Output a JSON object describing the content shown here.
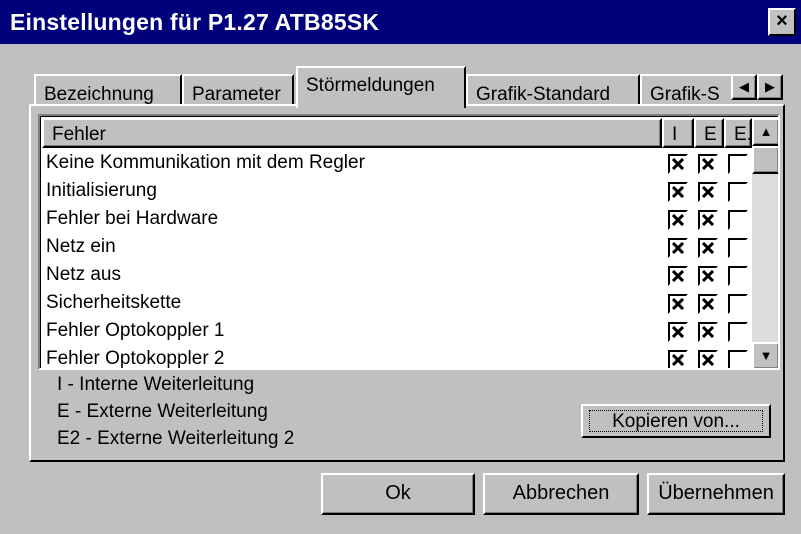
{
  "window": {
    "title": "Einstellungen für P1.27 ATB85SK",
    "close_label": "×"
  },
  "tabs": [
    {
      "label": "Bezeichnung",
      "active": false
    },
    {
      "label": "Parameter",
      "active": false
    },
    {
      "label": "Störmeldungen",
      "active": true
    },
    {
      "label": "Grafik-Standard",
      "active": false
    },
    {
      "label": "Grafik-S",
      "active": false
    }
  ],
  "tab_scroll": {
    "left": "◀",
    "right": "▶"
  },
  "list": {
    "columns": {
      "fehler": "Fehler",
      "i": "I",
      "e": "E",
      "e2": "E.."
    },
    "rows": [
      {
        "label": "Keine Kommunikation mit dem Regler",
        "i": true,
        "e": true,
        "e2": false
      },
      {
        "label": "Initialisierung",
        "i": true,
        "e": true,
        "e2": false
      },
      {
        "label": "Fehler bei Hardware",
        "i": true,
        "e": true,
        "e2": false
      },
      {
        "label": "Netz ein",
        "i": true,
        "e": true,
        "e2": false
      },
      {
        "label": "Netz aus",
        "i": true,
        "e": true,
        "e2": false
      },
      {
        "label": "Sicherheitskette",
        "i": true,
        "e": true,
        "e2": false
      },
      {
        "label": "Fehler Optokoppler 1",
        "i": true,
        "e": true,
        "e2": false
      },
      {
        "label": "Fehler Optokoppler 2",
        "i": true,
        "e": true,
        "e2": false
      }
    ],
    "scroll_up": "▲",
    "scroll_down": "▼"
  },
  "legend": [
    "I - Interne Weiterleitung",
    "E - Externe Weiterleitung",
    "E2 - Externe Weiterleitung 2"
  ],
  "copy_button": "Kopieren von...",
  "buttons": {
    "ok": "Ok",
    "cancel": "Abbrechen",
    "apply": "Übernehmen"
  }
}
